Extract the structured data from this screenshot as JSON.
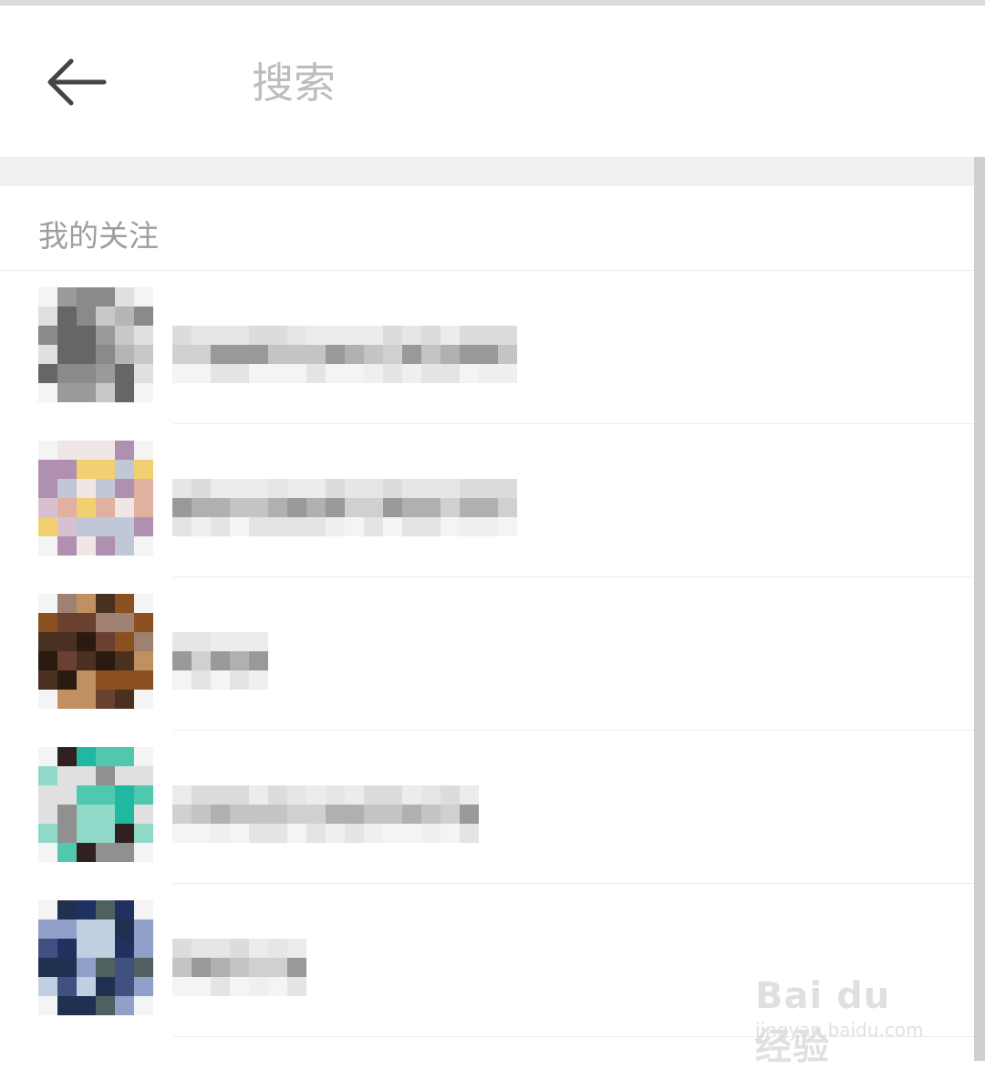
{
  "header": {
    "back_icon": "arrow-left-icon",
    "search_placeholder": "搜索"
  },
  "section": {
    "title": "我的关注"
  },
  "follow_list": {
    "item_count_visible": 5,
    "avatar_palettes": [
      [
        "#9a9a9a",
        "#666666",
        "#c8c8c8",
        "#e0e0e0",
        "#8a8a8a",
        "#b5b5b5"
      ],
      [
        "#f0d070",
        "#e0b0a0",
        "#b090b0",
        "#d8c0d0",
        "#c0c8d8",
        "#f0e6e6"
      ],
      [
        "#4a3020",
        "#8a5020",
        "#6a4030",
        "#2a1a10",
        "#a08070",
        "#c09060"
      ],
      [
        "#20b8a0",
        "#50c8b0",
        "#909090",
        "#e0e0e0",
        "#302020",
        "#90d8c8"
      ],
      [
        "#203060",
        "#405080",
        "#506060",
        "#203050",
        "#90a0c8",
        "#c0d0e0"
      ]
    ]
  },
  "watermark": {
    "brand": "Bai du 经验",
    "url": "jingyan.baidu.com"
  }
}
